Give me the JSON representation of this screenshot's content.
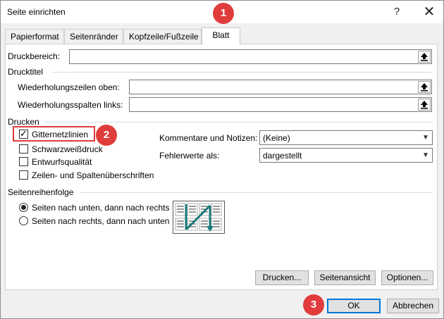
{
  "window": {
    "title": "Seite einrichten",
    "help_label": "?",
    "close_label": "✕"
  },
  "tabs": [
    {
      "label": "Papierformat"
    },
    {
      "label": "Seitenränder"
    },
    {
      "label": "Kopfzeile/Fußzeile"
    },
    {
      "label": "Blatt"
    }
  ],
  "print_area": {
    "label": "Druckbereich:",
    "value": ""
  },
  "print_titles": {
    "heading": "Drucktitel",
    "rows_label": "Wiederholungszeilen oben:",
    "rows_value": "",
    "cols_label": "Wiederholungsspalten links:",
    "cols_value": ""
  },
  "print": {
    "heading": "Drucken",
    "options": [
      {
        "label": "Gitternetzlinien",
        "checked": true
      },
      {
        "label": "Schwarzweißdruck",
        "checked": false
      },
      {
        "label": "Entwurfsqualität",
        "checked": false
      },
      {
        "label": "Zeilen- und Spaltenüberschriften",
        "checked": false
      }
    ],
    "comments_label": "Kommentare und Notizen:",
    "comments_value": "(Keine)",
    "errors_label": "Fehlerwerte als:",
    "errors_value": "dargestellt"
  },
  "page_order": {
    "heading": "Seitenreihenfolge",
    "options": [
      {
        "label": "Seiten nach unten, dann nach rechts",
        "selected": true
      },
      {
        "label": "Seiten nach rechts, dann nach unten",
        "selected": false
      }
    ]
  },
  "buttons": {
    "print": "Drucken...",
    "preview": "Seitenansicht",
    "options": "Optionen...",
    "ok": "OK",
    "cancel": "Abbrechen"
  },
  "annotations": {
    "b1": "1",
    "b2": "2",
    "b3": "3"
  },
  "colors": {
    "badge": "#e03c3c",
    "focus": "#0078d7",
    "arrow": "#1a7a7a"
  }
}
